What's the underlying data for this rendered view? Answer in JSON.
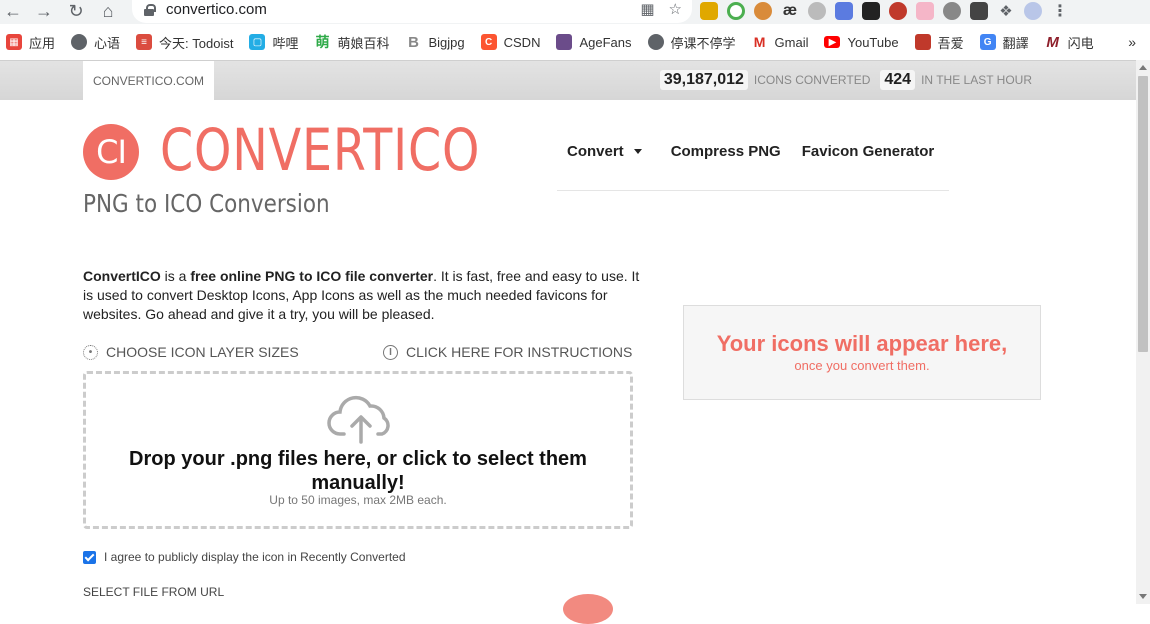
{
  "browser": {
    "url": "convertico.com",
    "bookmarks": [
      {
        "label": "应用",
        "icon": "apps-grid-icon",
        "color": "#e8453c"
      },
      {
        "label": "心语",
        "icon": "globe-icon",
        "color": "#5f6368"
      },
      {
        "label": "今天: Todoist",
        "icon": "todoist-icon",
        "color": "#db4c3f"
      },
      {
        "label": "哔哩",
        "icon": "bilibili-icon",
        "color": "#23ade5"
      },
      {
        "label": "萌娘百科",
        "icon": "moegirl-icon",
        "color": "#2eaa48"
      },
      {
        "label": "Bigjpg",
        "icon": "bigjpg-icon",
        "color": "#888888"
      },
      {
        "label": "CSDN",
        "icon": "csdn-icon",
        "color": "#fc5531"
      },
      {
        "label": "AgeFans",
        "icon": "agefans-icon",
        "color": "#6b4c8a"
      },
      {
        "label": "停课不停学",
        "icon": "globe-icon",
        "color": "#5f6368"
      },
      {
        "label": "Gmail",
        "icon": "gmail-icon",
        "color": "#d93025"
      },
      {
        "label": "YouTube",
        "icon": "youtube-icon",
        "color": "#ff0000"
      },
      {
        "label": "吾爱",
        "icon": "52pojie-icon",
        "color": "#c0392b"
      },
      {
        "label": "翻譯",
        "icon": "google-translate-icon",
        "color": "#4285f4"
      },
      {
        "label": "闪电",
        "icon": "shandian-icon",
        "color": "#8e1f2b"
      }
    ],
    "bookmarks_more": "»"
  },
  "strip": {
    "site_tab": "CONVERTICO.COM",
    "icons_converted_count": "39,187,012",
    "icons_converted_label": "icons converted",
    "last_hour_count": "424",
    "last_hour_label": "in the last hour"
  },
  "logo": {
    "mark": "CI",
    "name": "CONVERTICO",
    "tagline": "PNG to ICO Conversion"
  },
  "nav": {
    "convert": "Convert",
    "compress": "Compress PNG",
    "favicon": "Favicon Generator"
  },
  "intro": {
    "brand": "ConvertICO",
    "is_a": " is a ",
    "highlight": "free online PNG to ICO file converter",
    "rest": ". It is fast, free and easy to use. It is used to convert Desktop Icons, App Icons as well as the much needed favicons for websites. Go ahead and give it a try, you will be pleased."
  },
  "options": {
    "sizes": "Choose icon layer sizes",
    "instructions": "Click here for instructions"
  },
  "dropzone": {
    "title": "Drop your .png files here, or click to select them manually!",
    "subtitle": "Up to 50 images, max 2MB each."
  },
  "agree": "I agree to publicly display the icon in Recently Converted",
  "select_url": "Select file from URL",
  "icons_box": {
    "heading": "Your icons will appear here,",
    "sub": "once you convert them."
  },
  "colors": {
    "brand": "#f06e64",
    "checkbox": "#1a73e8"
  }
}
